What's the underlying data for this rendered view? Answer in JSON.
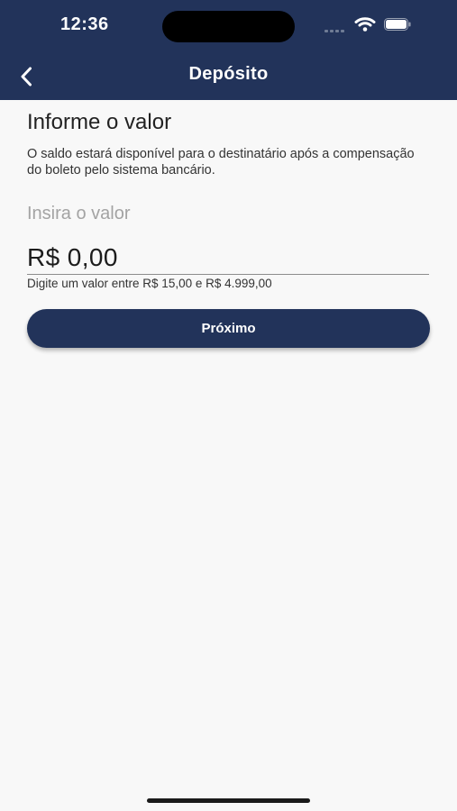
{
  "status_bar": {
    "time": "12:36"
  },
  "header": {
    "title": "Depósito",
    "back_icon": "chevron-left-icon"
  },
  "form": {
    "title": "Informe o valor",
    "description": "O saldo estará disponível para o destinatário após a compensação do boleto pelo sistema bancário.",
    "value_label": "Insira o valor",
    "amount_value": "R$ 0,00",
    "hint": "Digite um valor entre R$ 15,00 e R$ 4.999,00"
  },
  "actions": {
    "next_label": "Próximo"
  },
  "colors": {
    "primary": "#22335a",
    "background": "#f8f8f8"
  }
}
